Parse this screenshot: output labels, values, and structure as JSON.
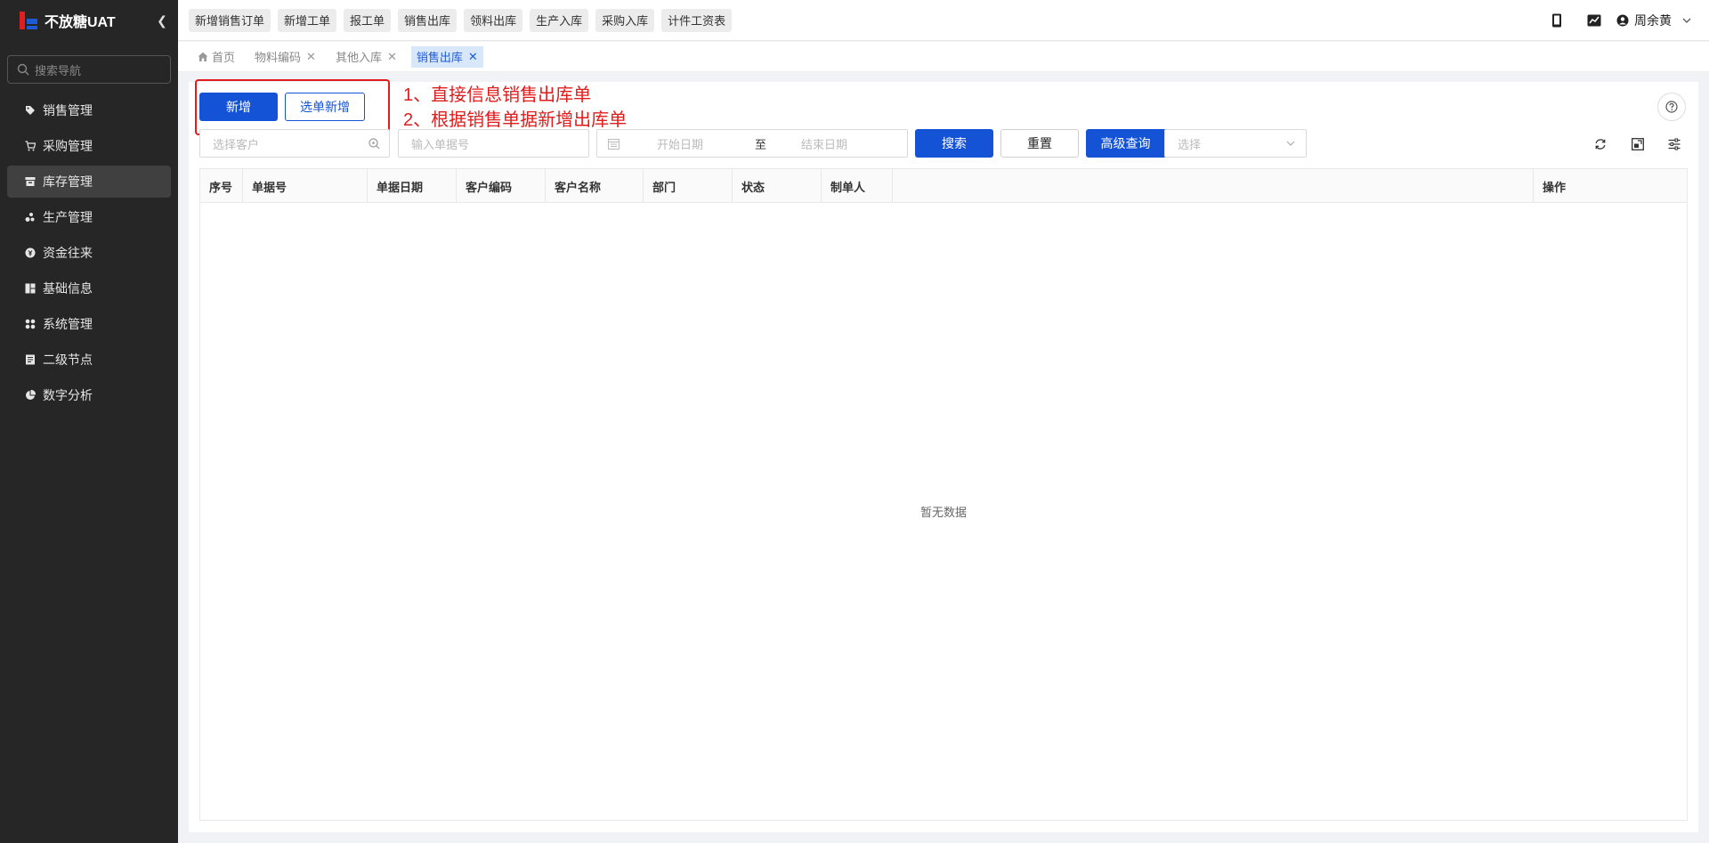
{
  "app": {
    "title": "不放糖UAT"
  },
  "sidebar": {
    "search_placeholder": "搜索导航",
    "items": [
      {
        "label": "销售管理",
        "icon": "tag-icon"
      },
      {
        "label": "采购管理",
        "icon": "cart-icon"
      },
      {
        "label": "库存管理",
        "icon": "warehouse-icon",
        "active": true
      },
      {
        "label": "生产管理",
        "icon": "production-icon"
      },
      {
        "label": "资金往来",
        "icon": "money-icon"
      },
      {
        "label": "基础信息",
        "icon": "layout-icon"
      },
      {
        "label": "系统管理",
        "icon": "apps-icon"
      },
      {
        "label": "二级节点",
        "icon": "document-icon"
      },
      {
        "label": "数字分析",
        "icon": "pie-chart-icon"
      }
    ]
  },
  "topbar": {
    "quick_links": [
      "新增销售订单",
      "新增工单",
      "报工单",
      "销售出库",
      "领料出库",
      "生产入库",
      "采购入库",
      "计件工资表"
    ],
    "user_name": "周余黄"
  },
  "tabs": [
    {
      "label": "首页",
      "closable": false,
      "active": false
    },
    {
      "label": "物料编码",
      "closable": true,
      "active": false
    },
    {
      "label": "其他入库",
      "closable": true,
      "active": false
    },
    {
      "label": "销售出库",
      "closable": true,
      "active": true
    }
  ],
  "toolbar": {
    "add_label": "新增",
    "add_from_order_label": "选单新增"
  },
  "annotation": {
    "line1": "1、直接信息销售出库单",
    "line2": "2、根据销售单据新增出库单"
  },
  "filters": {
    "customer_placeholder": "选择客户",
    "doc_no_placeholder": "输入单据号",
    "start_date_placeholder": "开始日期",
    "date_separator": "至",
    "end_date_placeholder": "结束日期",
    "search_label": "搜索",
    "reset_label": "重置",
    "advanced_label": "高级查询",
    "select_placeholder": "选择"
  },
  "table": {
    "columns": [
      "序号",
      "单据号",
      "单据日期",
      "客户编码",
      "客户名称",
      "部门",
      "状态",
      "制单人",
      "",
      "操作"
    ],
    "rows": [],
    "empty_text": "暂无数据"
  },
  "colors": {
    "primary": "#1553d6",
    "sidebar_bg": "#262626",
    "annotation": "#e01c1c"
  }
}
